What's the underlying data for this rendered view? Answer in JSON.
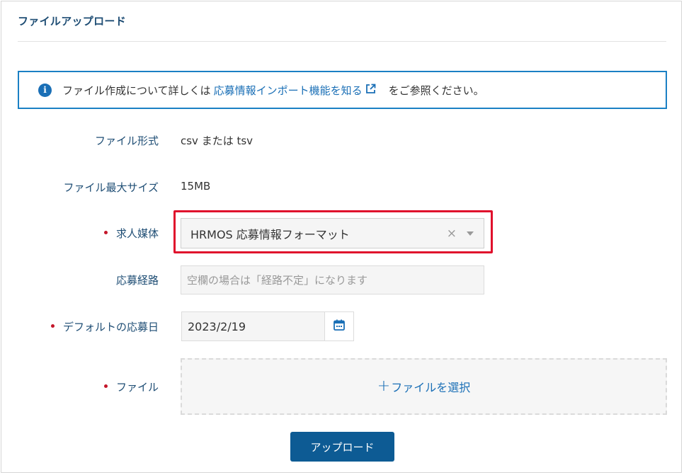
{
  "page": {
    "title": "ファイルアップロード"
  },
  "info": {
    "prefix": "ファイル作成について詳しくは",
    "link_text": "応募情報インポート機能を知る",
    "suffix": "をご参照ください。"
  },
  "form": {
    "file_format": {
      "label": "ファイル形式",
      "value": "csv または tsv"
    },
    "max_size": {
      "label": "ファイル最大サイズ",
      "value": "15MB"
    },
    "media": {
      "label": "求人媒体",
      "value": "HRMOS 応募情報フォーマット",
      "clear": "×",
      "required": true
    },
    "route": {
      "label": "応募経路",
      "placeholder": "空欄の場合は「経路不定」になります"
    },
    "default_date": {
      "label": "デフォルトの応募日",
      "value": "2023/2/19",
      "required": true
    },
    "file": {
      "label": "ファイル",
      "plus": "+",
      "select_text": "ファイルを選択",
      "required": true
    }
  },
  "actions": {
    "upload_label": "アップロード"
  },
  "colors": {
    "accent": "#1a6fb6",
    "label": "#1e4d74",
    "required": "#c4162a",
    "highlight": "#e0102c",
    "primary_button": "#0d5b94"
  },
  "icons": {
    "info": "info-icon",
    "external_link": "external-link-icon",
    "clear": "close-icon",
    "dropdown": "chevron-down-icon",
    "calendar": "calendar-icon",
    "plus": "plus-icon"
  }
}
